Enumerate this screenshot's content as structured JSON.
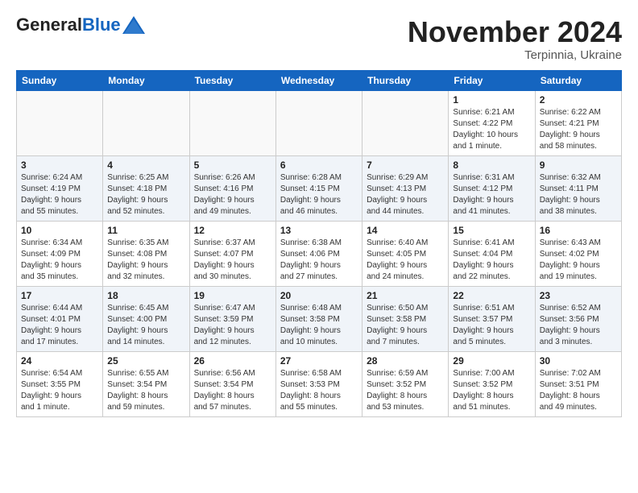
{
  "header": {
    "logo_line1": "General",
    "logo_line2": "Blue",
    "month": "November 2024",
    "location": "Terpinnia, Ukraine"
  },
  "weekdays": [
    "Sunday",
    "Monday",
    "Tuesday",
    "Wednesday",
    "Thursday",
    "Friday",
    "Saturday"
  ],
  "weeks": [
    [
      {
        "day": "",
        "info": ""
      },
      {
        "day": "",
        "info": ""
      },
      {
        "day": "",
        "info": ""
      },
      {
        "day": "",
        "info": ""
      },
      {
        "day": "",
        "info": ""
      },
      {
        "day": "1",
        "info": "Sunrise: 6:21 AM\nSunset: 4:22 PM\nDaylight: 10 hours\nand 1 minute."
      },
      {
        "day": "2",
        "info": "Sunrise: 6:22 AM\nSunset: 4:21 PM\nDaylight: 9 hours\nand 58 minutes."
      }
    ],
    [
      {
        "day": "3",
        "info": "Sunrise: 6:24 AM\nSunset: 4:19 PM\nDaylight: 9 hours\nand 55 minutes."
      },
      {
        "day": "4",
        "info": "Sunrise: 6:25 AM\nSunset: 4:18 PM\nDaylight: 9 hours\nand 52 minutes."
      },
      {
        "day": "5",
        "info": "Sunrise: 6:26 AM\nSunset: 4:16 PM\nDaylight: 9 hours\nand 49 minutes."
      },
      {
        "day": "6",
        "info": "Sunrise: 6:28 AM\nSunset: 4:15 PM\nDaylight: 9 hours\nand 46 minutes."
      },
      {
        "day": "7",
        "info": "Sunrise: 6:29 AM\nSunset: 4:13 PM\nDaylight: 9 hours\nand 44 minutes."
      },
      {
        "day": "8",
        "info": "Sunrise: 6:31 AM\nSunset: 4:12 PM\nDaylight: 9 hours\nand 41 minutes."
      },
      {
        "day": "9",
        "info": "Sunrise: 6:32 AM\nSunset: 4:11 PM\nDaylight: 9 hours\nand 38 minutes."
      }
    ],
    [
      {
        "day": "10",
        "info": "Sunrise: 6:34 AM\nSunset: 4:09 PM\nDaylight: 9 hours\nand 35 minutes."
      },
      {
        "day": "11",
        "info": "Sunrise: 6:35 AM\nSunset: 4:08 PM\nDaylight: 9 hours\nand 32 minutes."
      },
      {
        "day": "12",
        "info": "Sunrise: 6:37 AM\nSunset: 4:07 PM\nDaylight: 9 hours\nand 30 minutes."
      },
      {
        "day": "13",
        "info": "Sunrise: 6:38 AM\nSunset: 4:06 PM\nDaylight: 9 hours\nand 27 minutes."
      },
      {
        "day": "14",
        "info": "Sunrise: 6:40 AM\nSunset: 4:05 PM\nDaylight: 9 hours\nand 24 minutes."
      },
      {
        "day": "15",
        "info": "Sunrise: 6:41 AM\nSunset: 4:04 PM\nDaylight: 9 hours\nand 22 minutes."
      },
      {
        "day": "16",
        "info": "Sunrise: 6:43 AM\nSunset: 4:02 PM\nDaylight: 9 hours\nand 19 minutes."
      }
    ],
    [
      {
        "day": "17",
        "info": "Sunrise: 6:44 AM\nSunset: 4:01 PM\nDaylight: 9 hours\nand 17 minutes."
      },
      {
        "day": "18",
        "info": "Sunrise: 6:45 AM\nSunset: 4:00 PM\nDaylight: 9 hours\nand 14 minutes."
      },
      {
        "day": "19",
        "info": "Sunrise: 6:47 AM\nSunset: 3:59 PM\nDaylight: 9 hours\nand 12 minutes."
      },
      {
        "day": "20",
        "info": "Sunrise: 6:48 AM\nSunset: 3:58 PM\nDaylight: 9 hours\nand 10 minutes."
      },
      {
        "day": "21",
        "info": "Sunrise: 6:50 AM\nSunset: 3:58 PM\nDaylight: 9 hours\nand 7 minutes."
      },
      {
        "day": "22",
        "info": "Sunrise: 6:51 AM\nSunset: 3:57 PM\nDaylight: 9 hours\nand 5 minutes."
      },
      {
        "day": "23",
        "info": "Sunrise: 6:52 AM\nSunset: 3:56 PM\nDaylight: 9 hours\nand 3 minutes."
      }
    ],
    [
      {
        "day": "24",
        "info": "Sunrise: 6:54 AM\nSunset: 3:55 PM\nDaylight: 9 hours\nand 1 minute."
      },
      {
        "day": "25",
        "info": "Sunrise: 6:55 AM\nSunset: 3:54 PM\nDaylight: 8 hours\nand 59 minutes."
      },
      {
        "day": "26",
        "info": "Sunrise: 6:56 AM\nSunset: 3:54 PM\nDaylight: 8 hours\nand 57 minutes."
      },
      {
        "day": "27",
        "info": "Sunrise: 6:58 AM\nSunset: 3:53 PM\nDaylight: 8 hours\nand 55 minutes."
      },
      {
        "day": "28",
        "info": "Sunrise: 6:59 AM\nSunset: 3:52 PM\nDaylight: 8 hours\nand 53 minutes."
      },
      {
        "day": "29",
        "info": "Sunrise: 7:00 AM\nSunset: 3:52 PM\nDaylight: 8 hours\nand 51 minutes."
      },
      {
        "day": "30",
        "info": "Sunrise: 7:02 AM\nSunset: 3:51 PM\nDaylight: 8 hours\nand 49 minutes."
      }
    ]
  ]
}
